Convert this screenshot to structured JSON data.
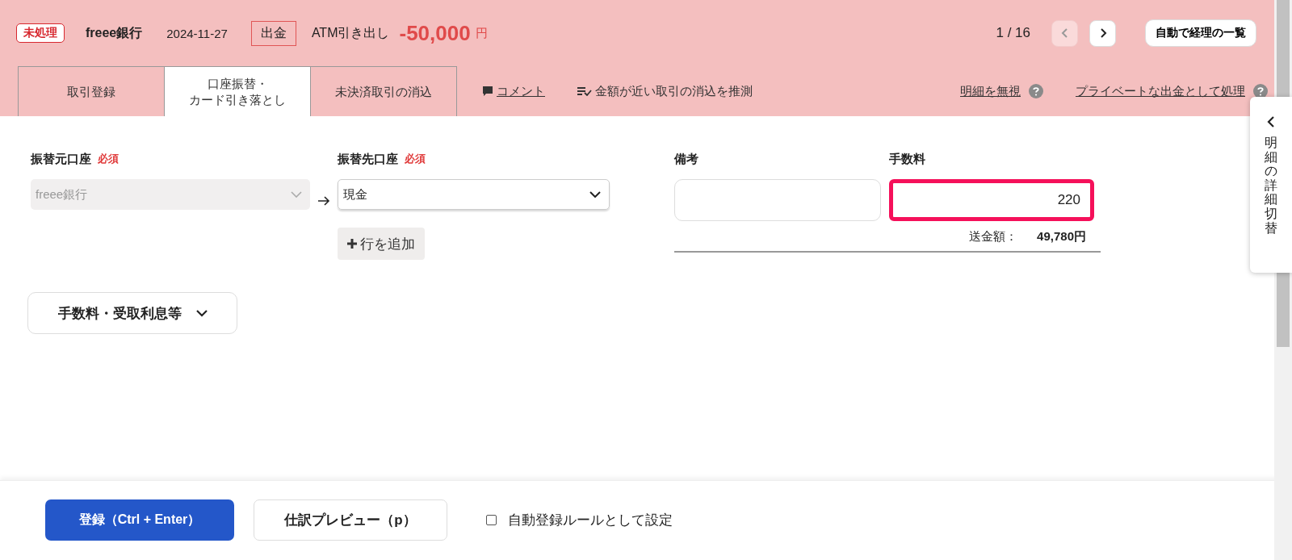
{
  "header": {
    "status_badge": "未処理",
    "bank": "freee銀行",
    "date": "2024-11-27",
    "type_badge": "出金",
    "description": "ATM引き出し",
    "amount": "-50,000",
    "currency": "円",
    "pager": {
      "text": "1 / 16",
      "prev_disabled": true,
      "next_disabled": false
    },
    "list_button": "自動で経理の一覧"
  },
  "tabs": [
    {
      "lines": [
        "取引登録"
      ],
      "selected": false
    },
    {
      "lines": [
        "口座振替・",
        "カード引き落とし"
      ],
      "selected": true
    },
    {
      "lines": [
        "未決済取引の消込"
      ],
      "selected": false
    }
  ],
  "actions": [
    {
      "label": "コメント",
      "kind": "comment"
    },
    {
      "label": "金額が近い取引の消込を推測",
      "kind": "guess"
    },
    {
      "label": "明細を無視",
      "kind": "help"
    },
    {
      "label": "プライベートな出金として処理",
      "kind": "help"
    }
  ],
  "form": {
    "from": {
      "label": "振替元口座",
      "required": "必須",
      "value": "freee銀行",
      "disabled": true
    },
    "to": {
      "label": "振替先口座",
      "required": "必須",
      "value": "現金",
      "disabled": false
    },
    "add_row": "行を追加",
    "memo": {
      "label": "備考"
    },
    "fee": {
      "label": "手数料",
      "value": "220",
      "highlighted": true
    },
    "total_label": "送金額：",
    "total_value": "49,780円",
    "collapse_button": "手数料・受取利息等"
  },
  "footer": {
    "submit": "登録（Ctrl + Enter）",
    "preview": "仕訳プレビュー（p）",
    "rule_checkbox": {
      "label": "自動登録ルールとして設定",
      "checked": false
    }
  },
  "side_panel": {
    "label": "明細の詳細切替"
  }
}
